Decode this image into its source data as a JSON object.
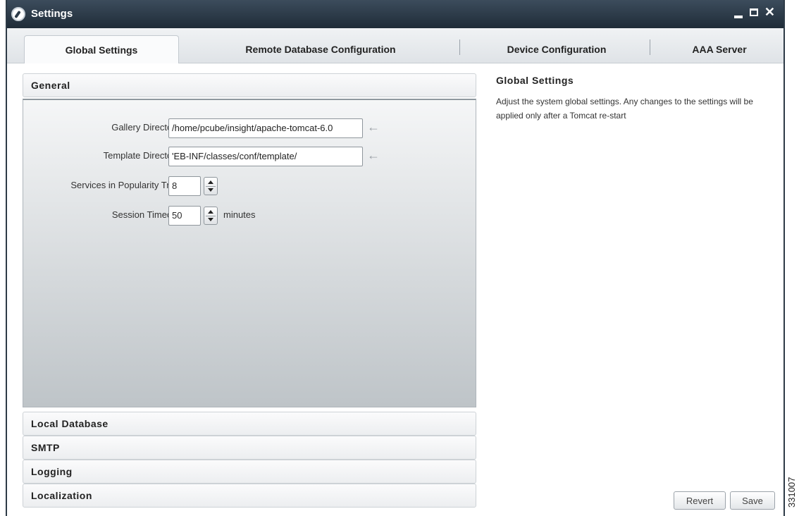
{
  "window": {
    "title": "Settings",
    "controls": {
      "minimize": "_",
      "close": "✕"
    }
  },
  "tabs": [
    {
      "label": "Global Settings"
    },
    {
      "label": "Remote Database Configuration"
    },
    {
      "label": "Device Configuration"
    },
    {
      "label": "AAA Server"
    }
  ],
  "accordion": {
    "general": "General",
    "local_database": "Local Database",
    "smtp": "SMTP",
    "logging": "Logging",
    "localization": "Localization"
  },
  "general_form": {
    "gallery_directory": {
      "label": "Gallery Directory",
      "value": "/home/pcube/insight/apache-tomcat-6.0"
    },
    "template_directory": {
      "label": "Template Directory",
      "value": "'EB-INF/classes/conf/template/"
    },
    "popularity_tree": {
      "label": "Services in Popularity Tree",
      "value": "8"
    },
    "session_timeout": {
      "label": "Session Timeout",
      "value": "50",
      "unit": "minutes"
    },
    "arrow_glyph": "←"
  },
  "help": {
    "title": "Global Settings",
    "text": "Adjust the system global settings. Any changes to the settings will be applied only after a Tomcat re-start"
  },
  "buttons": {
    "revert": "Revert",
    "save": "Save"
  },
  "figure_id": "331007"
}
